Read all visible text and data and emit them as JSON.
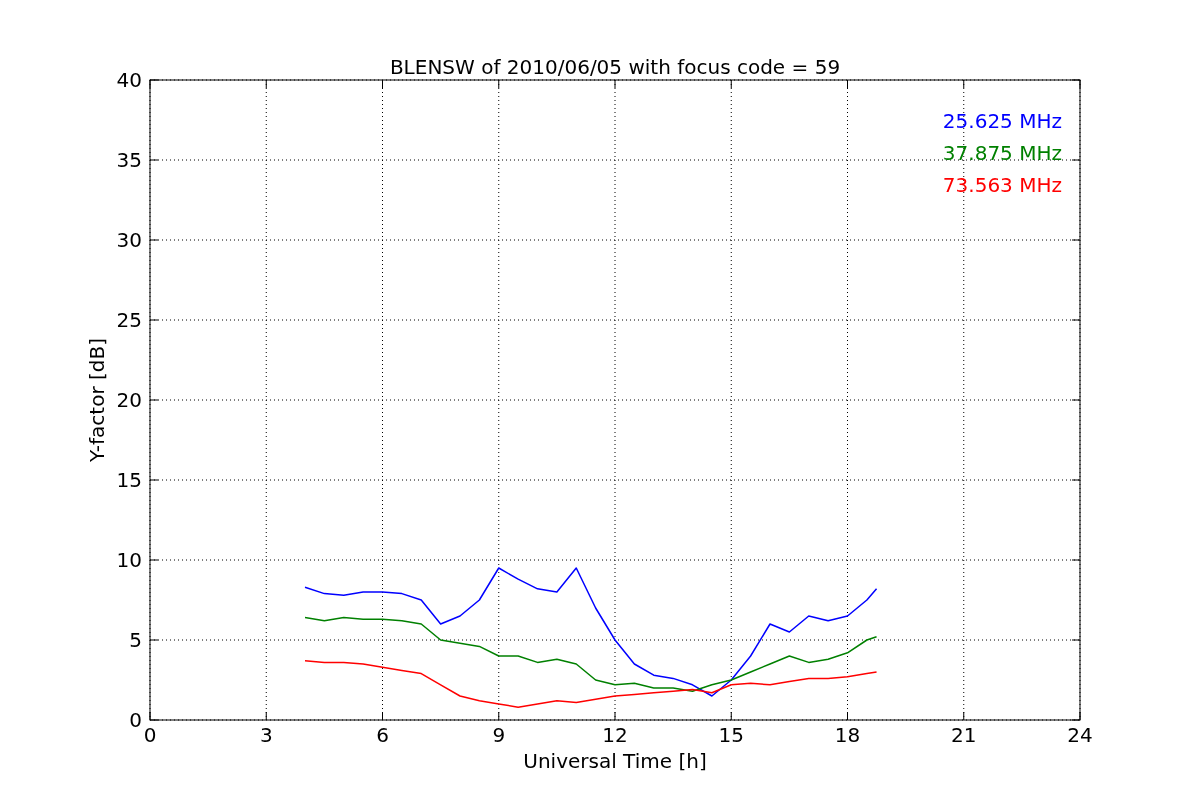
{
  "chart_data": {
    "type": "line",
    "title": "BLENSW of 2010/06/05 with focus code = 59",
    "xlabel": "Universal Time [h]",
    "ylabel": "Y-factor [dB]",
    "x": [
      4,
      4.5,
      5,
      5.5,
      6,
      6.5,
      7,
      7.5,
      8,
      8.5,
      9,
      9.5,
      10,
      10.5,
      11,
      11.5,
      12,
      12.5,
      13,
      13.5,
      14,
      14.5,
      15,
      15.5,
      16,
      16.5,
      17,
      17.5,
      18,
      18.5,
      18.75
    ],
    "series": [
      {
        "name": "25.625 MHz",
        "color": "#0000ff",
        "values": [
          8.3,
          7.9,
          7.8,
          8,
          8,
          7.9,
          7.5,
          6,
          6.5,
          7.5,
          9.5,
          8.8,
          8.2,
          8,
          9.5,
          7,
          5,
          3.5,
          2.8,
          2.6,
          2.2,
          1.5,
          2.5,
          4,
          6,
          5.5,
          6.5,
          6.2,
          6.5,
          7.5,
          8.2
        ]
      },
      {
        "name": "37.875 MHz",
        "color": "#008000",
        "values": [
          6.4,
          6.2,
          6.4,
          6.3,
          6.3,
          6.2,
          6,
          5,
          4.8,
          4.6,
          4,
          4,
          3.6,
          3.8,
          3.5,
          2.5,
          2.2,
          2.3,
          2,
          2,
          1.8,
          2.2,
          2.5,
          3,
          3.5,
          4,
          3.6,
          3.8,
          4.2,
          5,
          5.2
        ]
      },
      {
        "name": "73.563 MHz",
        "color": "#ff0000",
        "values": [
          3.7,
          3.6,
          3.6,
          3.5,
          3.3,
          3.1,
          2.9,
          2.2,
          1.5,
          1.2,
          1,
          0.8,
          1,
          1.2,
          1.1,
          1.3,
          1.5,
          1.6,
          1.7,
          1.8,
          1.9,
          1.7,
          2.2,
          2.3,
          2.2,
          2.4,
          2.6,
          2.6,
          2.7,
          2.9,
          3
        ]
      }
    ],
    "grid": true,
    "xlim": [
      0,
      24
    ],
    "ylim": [
      0,
      40
    ],
    "xticks": [
      0,
      3,
      6,
      9,
      12,
      15,
      18,
      21,
      24
    ],
    "yticks": [
      0,
      5,
      10,
      15,
      20,
      25,
      30,
      35,
      40
    ]
  }
}
